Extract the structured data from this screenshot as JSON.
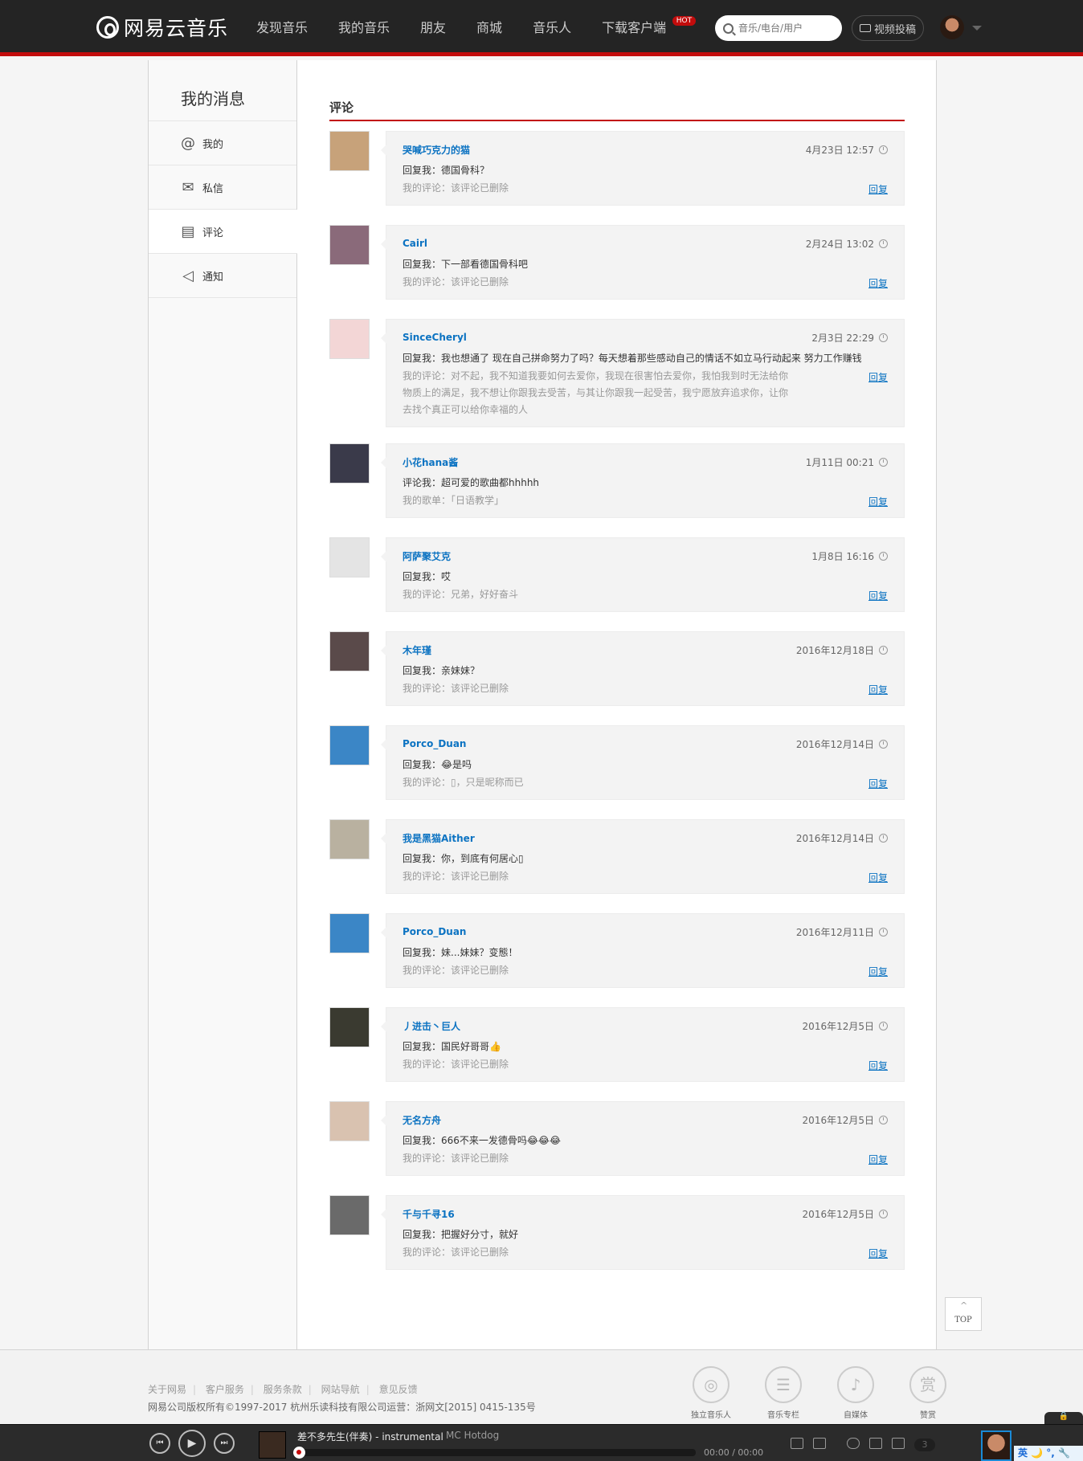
{
  "header": {
    "logo": "网易云音乐",
    "nav": [
      {
        "label": "发现音乐"
      },
      {
        "label": "我的音乐"
      },
      {
        "label": "朋友"
      },
      {
        "label": "商城"
      },
      {
        "label": "音乐人"
      },
      {
        "label": "下载客户端",
        "badge": "HOT"
      }
    ],
    "search_placeholder": "音乐/电台/用户",
    "video_button": "视频投稿"
  },
  "sidebar": {
    "title": "我的消息",
    "items": [
      {
        "label": "我的",
        "icon": "at-icon"
      },
      {
        "label": "私信",
        "icon": "envelope-icon"
      },
      {
        "label": "评论",
        "icon": "comment-icon",
        "active": true
      },
      {
        "label": "通知",
        "icon": "speaker-icon"
      }
    ]
  },
  "main": {
    "tab_title": "评论",
    "reply_label": "回复",
    "messages": [
      {
        "name": "哭喊巧克力的猫",
        "time": "4月23日 12:57",
        "text": "回复我：德国骨科？",
        "mine": "我的评论：该评论已删除",
        "avatar_color": "#c7a27a"
      },
      {
        "name": "Cairl",
        "time": "2月24日 13:02",
        "text": "回复我：下一部看德国骨科吧",
        "mine": "我的评论：该评论已删除",
        "avatar_color": "#8a6a7a"
      },
      {
        "name": "SinceCheryl",
        "time": "2月3日 22:29",
        "text": "回复我：我也想通了 现在自己拼命努力了吗？每天想着那些感动自己的情话不如立马行动起来 努力工作赚钱",
        "mine": "我的评论：对不起，我不知道我要如何去爱你，我现在很害怕去爱你，我怕我到时无法给你物质上的满足，我不想让你跟我去受苦，与其让你跟我一起受苦，我宁愿放弃追求你，让你去找个真正可以给你幸福的人",
        "avatar_color": "#f3d6d6"
      },
      {
        "name": "小花hana酱",
        "time": "1月11日 00:21",
        "text": "评论我：超可爱的歌曲都hhhhh",
        "mine": "我的歌单：「日语教学」",
        "avatar_color": "#3a3a4a"
      },
      {
        "name": "阿萨聚艾克",
        "time": "1月8日 16:16",
        "text": "回复我：哎",
        "mine": "我的评论：兄弟，好好奋斗",
        "avatar_color": "#e4e4e4"
      },
      {
        "name": "木年瑾",
        "time": "2016年12月18日",
        "text": "回复我：亲妹妹？",
        "mine": "我的评论：该评论已删除",
        "avatar_color": "#5a4a4a"
      },
      {
        "name": "Porco_Duan",
        "time": "2016年12月14日",
        "text": "回复我：😂是吗",
        "mine": "我的评论：▯，只是昵称而已",
        "avatar_color": "#3b86c6"
      },
      {
        "name": "我是黑猫Aither",
        "time": "2016年12月14日",
        "text": "回复我：你，到底有何居心▯",
        "mine": "我的评论：该评论已删除",
        "avatar_color": "#b9b1a0"
      },
      {
        "name": "Porco_Duan",
        "time": "2016年12月11日",
        "text": "回复我：妹...妹妹？变態！",
        "mine": "我的评论：该评论已删除",
        "avatar_color": "#3b86c6"
      },
      {
        "name": "丿进击丶巨人",
        "time": "2016年12月5日",
        "text": "回复我：国民好哥哥👍",
        "mine": "我的评论：该评论已删除",
        "avatar_color": "#3a3a30"
      },
      {
        "name": "无名方舟",
        "time": "2016年12月5日",
        "text": "回复我：666不来一发德骨吗😂😂😂",
        "mine": "我的评论：该评论已删除",
        "avatar_color": "#d9c2b0"
      },
      {
        "name": "千与千寻16",
        "time": "2016年12月5日",
        "text": "回复我：把握好分寸，就好",
        "mine": "我的评论：该评论已删除",
        "avatar_color": "#6a6a6a"
      }
    ]
  },
  "top_button": "TOP",
  "footer": {
    "links": [
      "关于网易",
      "客户服务",
      "服务条款",
      "网站导航",
      "意见反馈"
    ],
    "copyright": "网易公司版权所有©1997-2017   杭州乐读科技有限公司运营：浙网文[2015] 0415-135号",
    "badges": [
      {
        "label": "独立音乐人",
        "icon": "disc-icon"
      },
      {
        "label": "音乐专栏",
        "icon": "list-icon"
      },
      {
        "label": "自媒体",
        "icon": "mic-icon"
      },
      {
        "label": "赞赏",
        "icon": "reward-icon",
        "glyph": "赏"
      }
    ]
  },
  "player": {
    "song": "差不多先生(伴奏) - instrumental",
    "artist": "MC Hotdog",
    "time": "00:00 / 00:00",
    "playlist_count": "3",
    "progress": 0
  },
  "system": {
    "ime_label": "英 🌙 °, 🔧"
  }
}
